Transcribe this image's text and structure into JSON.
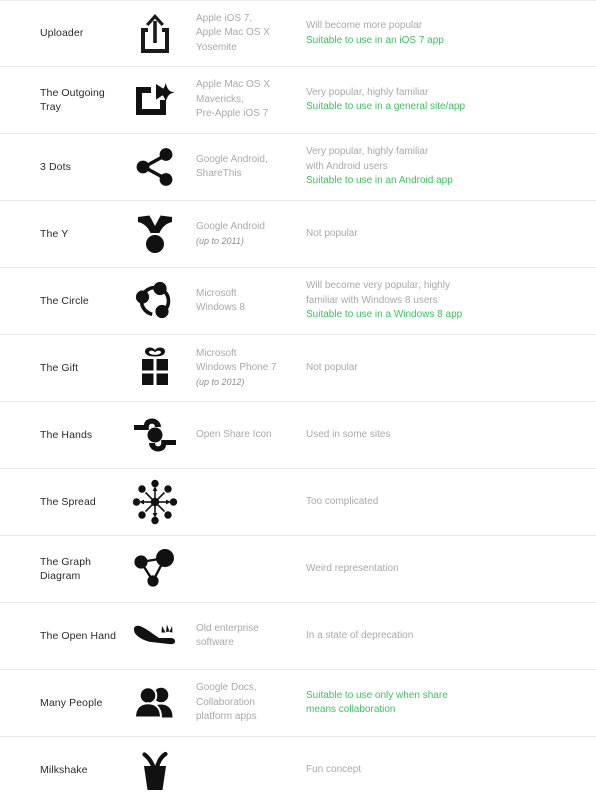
{
  "page": {
    "title": "Share Icon Comparison Table",
    "accent_green": "#3cc35f",
    "text_dark": "#2b2b2b",
    "text_grey": "#a9a9a9"
  },
  "rows": [
    {
      "name": "Uploader",
      "icon": "ios-share-upload-icon",
      "platform_lines": [
        "Apple iOS 7,",
        "Apple Mac OS X",
        "Yosemite"
      ],
      "platform_sub": "",
      "notes_grey": [
        "Will become more popular"
      ],
      "notes_green": [
        "Suitable to use in an iOS 7 app"
      ]
    },
    {
      "name": "The Outgoing Tray",
      "icon": "outgoing-tray-icon",
      "platform_lines": [
        "Apple Mac OS X",
        "Mavericks,",
        "Pre-Apple iOS 7"
      ],
      "platform_sub": "",
      "notes_grey": [
        "Very popular, highly familiar"
      ],
      "notes_green": [
        "Suitable to use in a general site/app"
      ]
    },
    {
      "name": "3 Dots",
      "icon": "three-dots-share-icon",
      "platform_lines": [
        "Google Android,",
        "ShareThis"
      ],
      "platform_sub": "",
      "notes_grey": [
        "Very popular, highly familiar",
        "with Android users"
      ],
      "notes_green": [
        "Suitable to use in an Android app"
      ]
    },
    {
      "name": "The Y",
      "icon": "the-y-icon",
      "platform_lines": [
        "Google Android"
      ],
      "platform_sub": "(up to 2011)",
      "notes_grey": [
        "Not popular"
      ],
      "notes_green": []
    },
    {
      "name": "The Circle",
      "icon": "the-circle-icon",
      "platform_lines": [
        "Microsoft",
        "Windows 8"
      ],
      "platform_sub": "",
      "notes_grey": [
        "Will become very popular; highly",
        "familiar with Windows 8 users"
      ],
      "notes_green": [
        "Suitable to use in a Windows 8 app"
      ]
    },
    {
      "name": "The Gift",
      "icon": "the-gift-icon",
      "platform_lines": [
        "Microsoft",
        "Windows Phone 7"
      ],
      "platform_sub": "(up to 2012)",
      "notes_grey": [
        "Not popular"
      ],
      "notes_green": []
    },
    {
      "name": "The Hands",
      "icon": "the-hands-icon",
      "platform_lines": [
        "Open Share Icon"
      ],
      "platform_sub": "",
      "notes_grey": [
        "Used in some sites"
      ],
      "notes_green": []
    },
    {
      "name": "The Spread",
      "icon": "the-spread-icon",
      "platform_lines": [],
      "platform_sub": "",
      "notes_grey": [
        "Too complicated"
      ],
      "notes_green": []
    },
    {
      "name": "The Graph Diagram",
      "icon": "the-graph-diagram-icon",
      "platform_lines": [],
      "platform_sub": "",
      "notes_grey": [
        "Weird representation"
      ],
      "notes_green": []
    },
    {
      "name": "The Open Hand",
      "icon": "the-open-hand-icon",
      "platform_lines": [
        "Old enterprise",
        "software"
      ],
      "platform_sub": "",
      "notes_grey": [
        "In a state of deprecation"
      ],
      "notes_green": []
    },
    {
      "name": "Many People",
      "icon": "many-people-icon",
      "platform_lines": [
        "Google Docs,",
        "Collaboration",
        "platform apps"
      ],
      "platform_sub": "",
      "notes_grey": [],
      "notes_green": [
        "Suitable to use only when share",
        "means collaboration"
      ]
    },
    {
      "name": "Milkshake",
      "icon": "milkshake-icon",
      "platform_lines": [],
      "platform_sub": "",
      "notes_grey": [
        "Fun concept"
      ],
      "notes_green": []
    }
  ]
}
